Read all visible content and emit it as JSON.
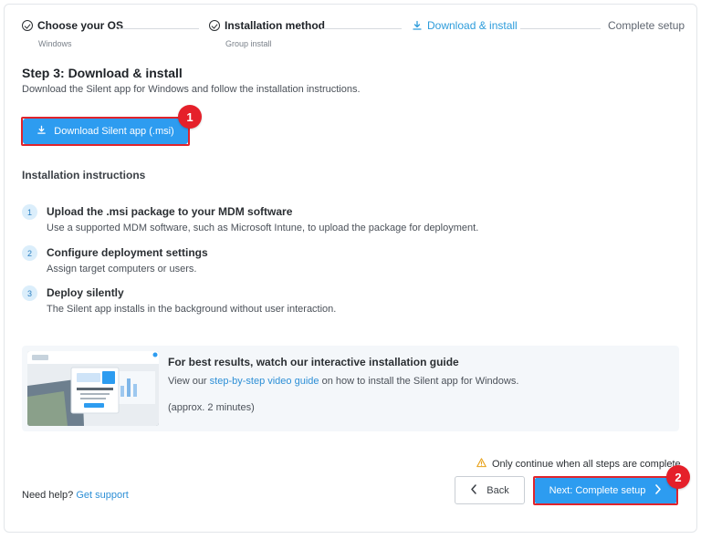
{
  "stepper": {
    "steps": [
      {
        "title": "Choose your OS",
        "subtitle": "Windows",
        "state": "done"
      },
      {
        "title": "Installation method",
        "subtitle": "Group install",
        "state": "done"
      },
      {
        "title": "Download & install",
        "subtitle": "",
        "state": "active"
      },
      {
        "title": "Complete setup",
        "subtitle": "",
        "state": "pending"
      }
    ]
  },
  "header": {
    "title": "Step 3: Download & install",
    "description": "Download the Silent app for Windows and follow the installation instructions."
  },
  "download_button": {
    "label": "Download Silent app (.msi)",
    "icon": "download-icon"
  },
  "annotations": {
    "badge_1": "1",
    "badge_2": "2",
    "highlight_color": "#e0242c"
  },
  "instructions": {
    "title": "Installation instructions",
    "items": [
      {
        "num": "1",
        "title": "Upload the .msi package to your MDM software",
        "desc": "Use a supported MDM software, such as Microsoft Intune, to upload the package for deployment."
      },
      {
        "num": "2",
        "title": "Configure deployment settings",
        "desc": "Assign target computers or users."
      },
      {
        "num": "3",
        "title": "Deploy silently",
        "desc": "The Silent app installs in the background without user interaction."
      }
    ]
  },
  "guide": {
    "title": "For best results, watch our interactive installation guide",
    "line_prefix": "View our ",
    "link_text": "step-by-step video guide",
    "line_suffix": " on how to install the Silent app for Windows.",
    "duration": "(approx. 2 minutes)"
  },
  "warning": {
    "text": "Only continue when all steps are complete",
    "icon": "warning-icon"
  },
  "help": {
    "prefix": "Need help? ",
    "link": "Get support"
  },
  "footer": {
    "back_label": "Back",
    "next_label": "Next: Complete setup"
  },
  "colors": {
    "accent": "#2d9cf0",
    "link": "#2d8fd6",
    "badge": "#e5202a"
  }
}
